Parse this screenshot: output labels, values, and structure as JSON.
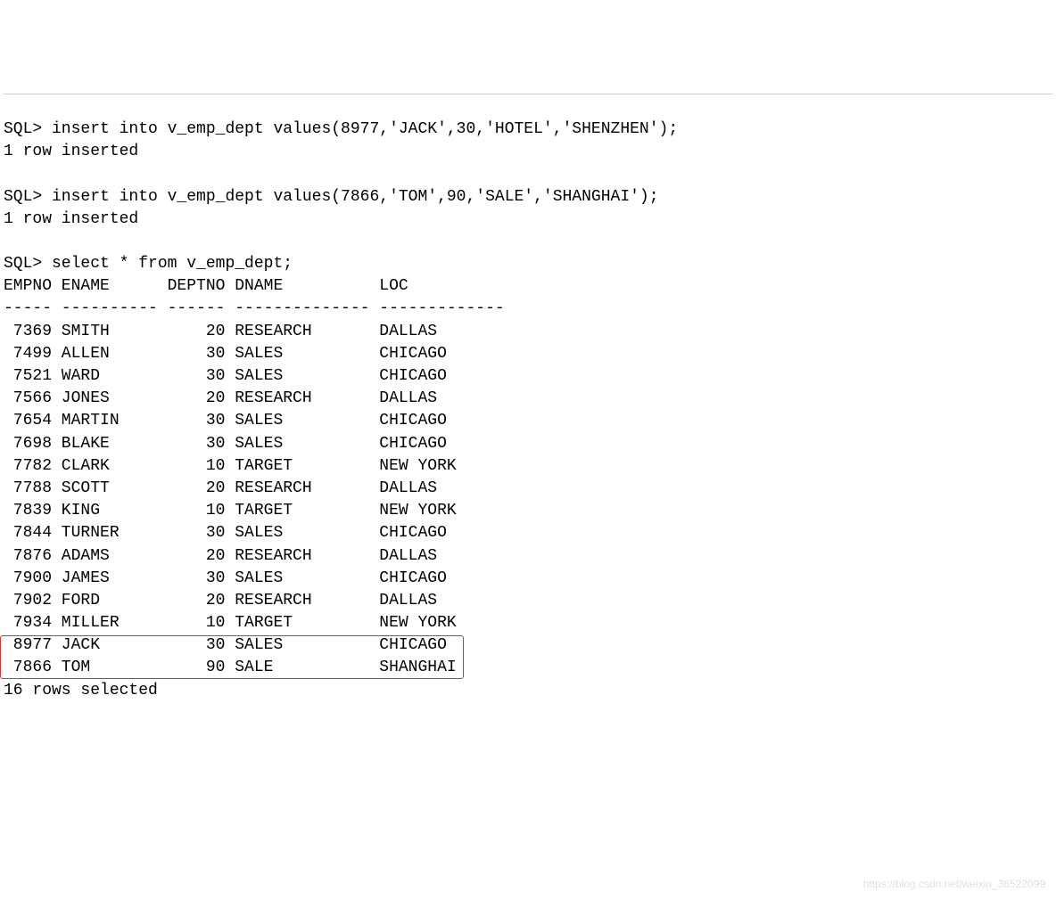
{
  "sql": {
    "insert1_line": "SQL> insert into v_emp_dept values(8977,'JACK',30,'HOTEL','SHENZHEN');",
    "insert1_result": "1 row inserted",
    "insert2_line": "SQL> insert into v_emp_dept values(7866,'TOM',90,'SALE','SHANGHAI');",
    "insert2_result": "1 row inserted",
    "select_line": "SQL> select * from v_emp_dept;",
    "header_line": "EMPNO ENAME      DEPTNO DNAME          LOC",
    "divider_line": "----- ---------- ------ -------------- -------------",
    "rows": [
      " 7369 SMITH          20 RESEARCH       DALLAS",
      " 7499 ALLEN          30 SALES          CHICAGO",
      " 7521 WARD           30 SALES          CHICAGO",
      " 7566 JONES          20 RESEARCH       DALLAS",
      " 7654 MARTIN         30 SALES          CHICAGO",
      " 7698 BLAKE          30 SALES          CHICAGO",
      " 7782 CLARK          10 TARGET         NEW YORK",
      " 7788 SCOTT          20 RESEARCH       DALLAS",
      " 7839 KING           10 TARGET         NEW YORK",
      " 7844 TURNER         30 SALES          CHICAGO",
      " 7876 ADAMS          20 RESEARCH       DALLAS",
      " 7900 JAMES          30 SALES          CHICAGO",
      " 7902 FORD           20 RESEARCH       DALLAS",
      " 7934 MILLER         10 TARGET         NEW YORK",
      " 8977 JACK           30 SALES          CHICAGO",
      " 7866 TOM            90 SALE           SHANGHAI"
    ],
    "footer_line": "16 rows selected"
  },
  "watermark_text": "https://blog.csdn.net/weixin_36522099"
}
